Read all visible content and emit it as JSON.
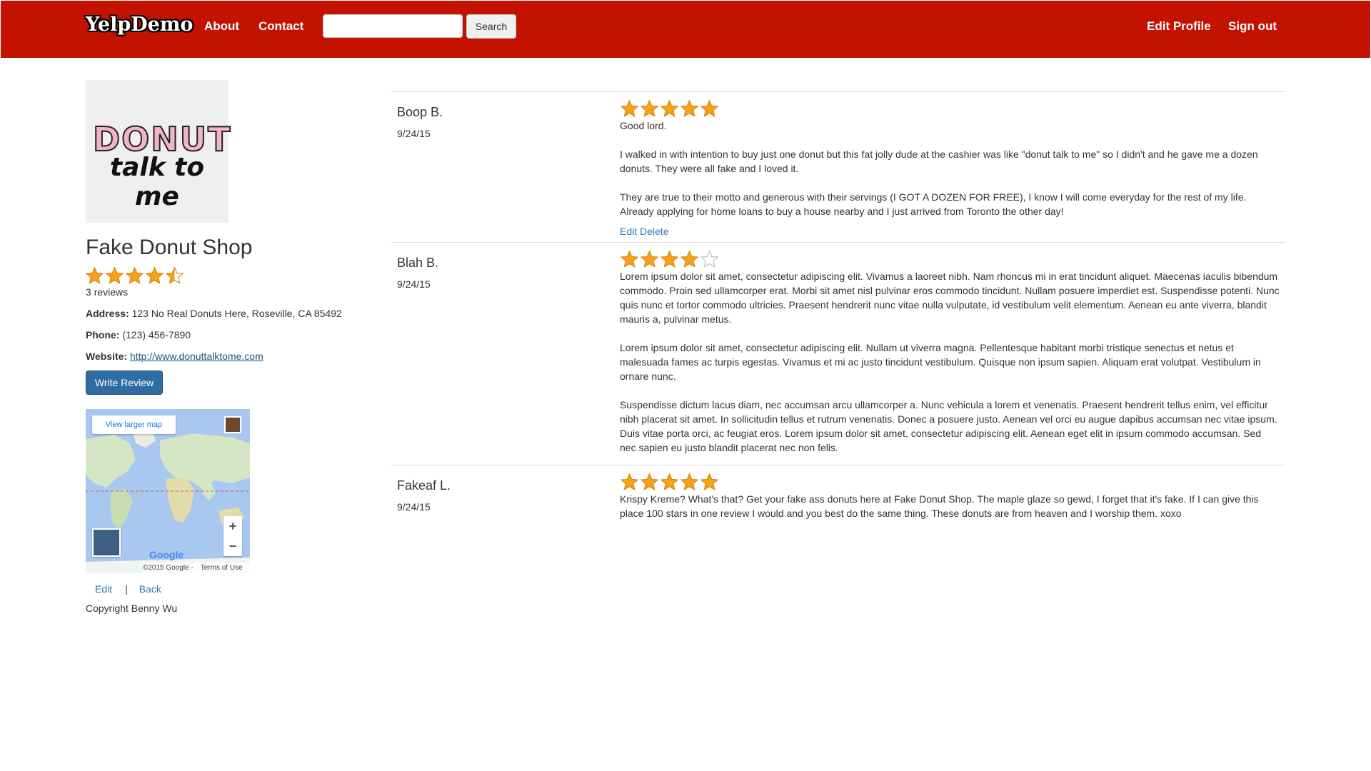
{
  "nav": {
    "brand": "YelpDemo",
    "about": "About",
    "contact": "Contact",
    "search_value": "",
    "search_button": "Search",
    "edit_profile": "Edit Profile",
    "sign_out": "Sign out"
  },
  "colors": {
    "navbar": "#c41200",
    "link": "#337ab7",
    "primary_button": "#2e6da4",
    "star_fill": "#f7a21b"
  },
  "shop": {
    "logo_line1": "DONUT",
    "logo_line2": "talk to me",
    "name": "Fake Donut Shop",
    "rating": 4.5,
    "reviews_count": "3 reviews",
    "address_label": "Address:",
    "address": "123 No Real Donuts Here, Roseville, CA 85492",
    "phone_label": "Phone:",
    "phone": "(123) 456-7890",
    "website_label": "Website:",
    "website": "http://www.donuttalktome.com",
    "write_review": "Write Review"
  },
  "map": {
    "view_larger": "View larger map",
    "zoom_in": "+",
    "zoom_out": "−",
    "google": "Google",
    "copyright": "©2015 Google -",
    "terms": "Terms of Use"
  },
  "footer": {
    "edit": "Edit",
    "separator": "|",
    "back": "Back",
    "copyright": "Copyright Benny Wu"
  },
  "reviews": [
    {
      "name": "Boop B.",
      "date": "9/24/15",
      "rating": 5,
      "paragraphs": [
        "Good lord.",
        "I walked in with intention to buy just one donut but this fat jolly dude at the cashier was like \"donut talk to me\" so I didn't and he gave me a dozen donuts. They were all fake and I loved it.",
        "They are true to their motto and generous with their servings (I GOT A DOZEN FOR FREE), I know I will come everyday for the rest of my life. Already applying for home loans to buy a house nearby and I just arrived from Toronto the other day!"
      ],
      "edit": "Edit",
      "delete": "Delete"
    },
    {
      "name": "Blah B.",
      "date": "9/24/15",
      "rating": 4,
      "paragraphs": [
        "Lorem ipsum dolor sit amet, consectetur adipiscing elit. Vivamus a laoreet nibh. Nam rhoncus mi in erat tincidunt aliquet. Maecenas iaculis bibendum commodo. Proin sed ullamcorper erat. Morbi sit amet nisl pulvinar eros commodo tincidunt. Nullam posuere imperdiet est. Suspendisse potenti. Nunc quis nunc et tortor commodo ultricies. Praesent hendrerit nunc vitae nulla vulputate, id vestibulum velit elementum. Aenean eu ante viverra, blandit mauris a, pulvinar metus.",
        "Lorem ipsum dolor sit amet, consectetur adipiscing elit. Nullam ut viverra magna. Pellentesque habitant morbi tristique senectus et netus et malesuada fames ac turpis egestas. Vivamus et mi ac justo tincidunt vestibulum. Quisque non ipsum sapien. Aliquam erat volutpat. Vestibulum in ornare nunc.",
        "Suspendisse dictum lacus diam, nec accumsan arcu ullamcorper a. Nunc vehicula a lorem et venenatis. Praesent hendrerit tellus enim, vel efficitur nibh placerat sit amet. In sollicitudin tellus et rutrum venenatis. Donec a posuere justo. Aenean vel orci eu augue dapibus accumsan nec vitae ipsum. Duis vitae porta orci, ac feugiat eros. Lorem ipsum dolor sit amet, consectetur adipiscing elit. Aenean eget elit in ipsum commodo accumsan. Sed nec sapien eu justo blandit placerat nec non felis."
      ]
    },
    {
      "name": "Fakeaf L.",
      "date": "9/24/15",
      "rating": 5,
      "paragraphs": [
        "Krispy Kreme? What's that? Get your fake ass donuts here at Fake Donut Shop. The maple glaze so gewd, I forget that it's fake. If I can give this place 100 stars in one review I would and you best do the same thing. These donuts are from heaven and I worship them. xoxo"
      ]
    }
  ]
}
